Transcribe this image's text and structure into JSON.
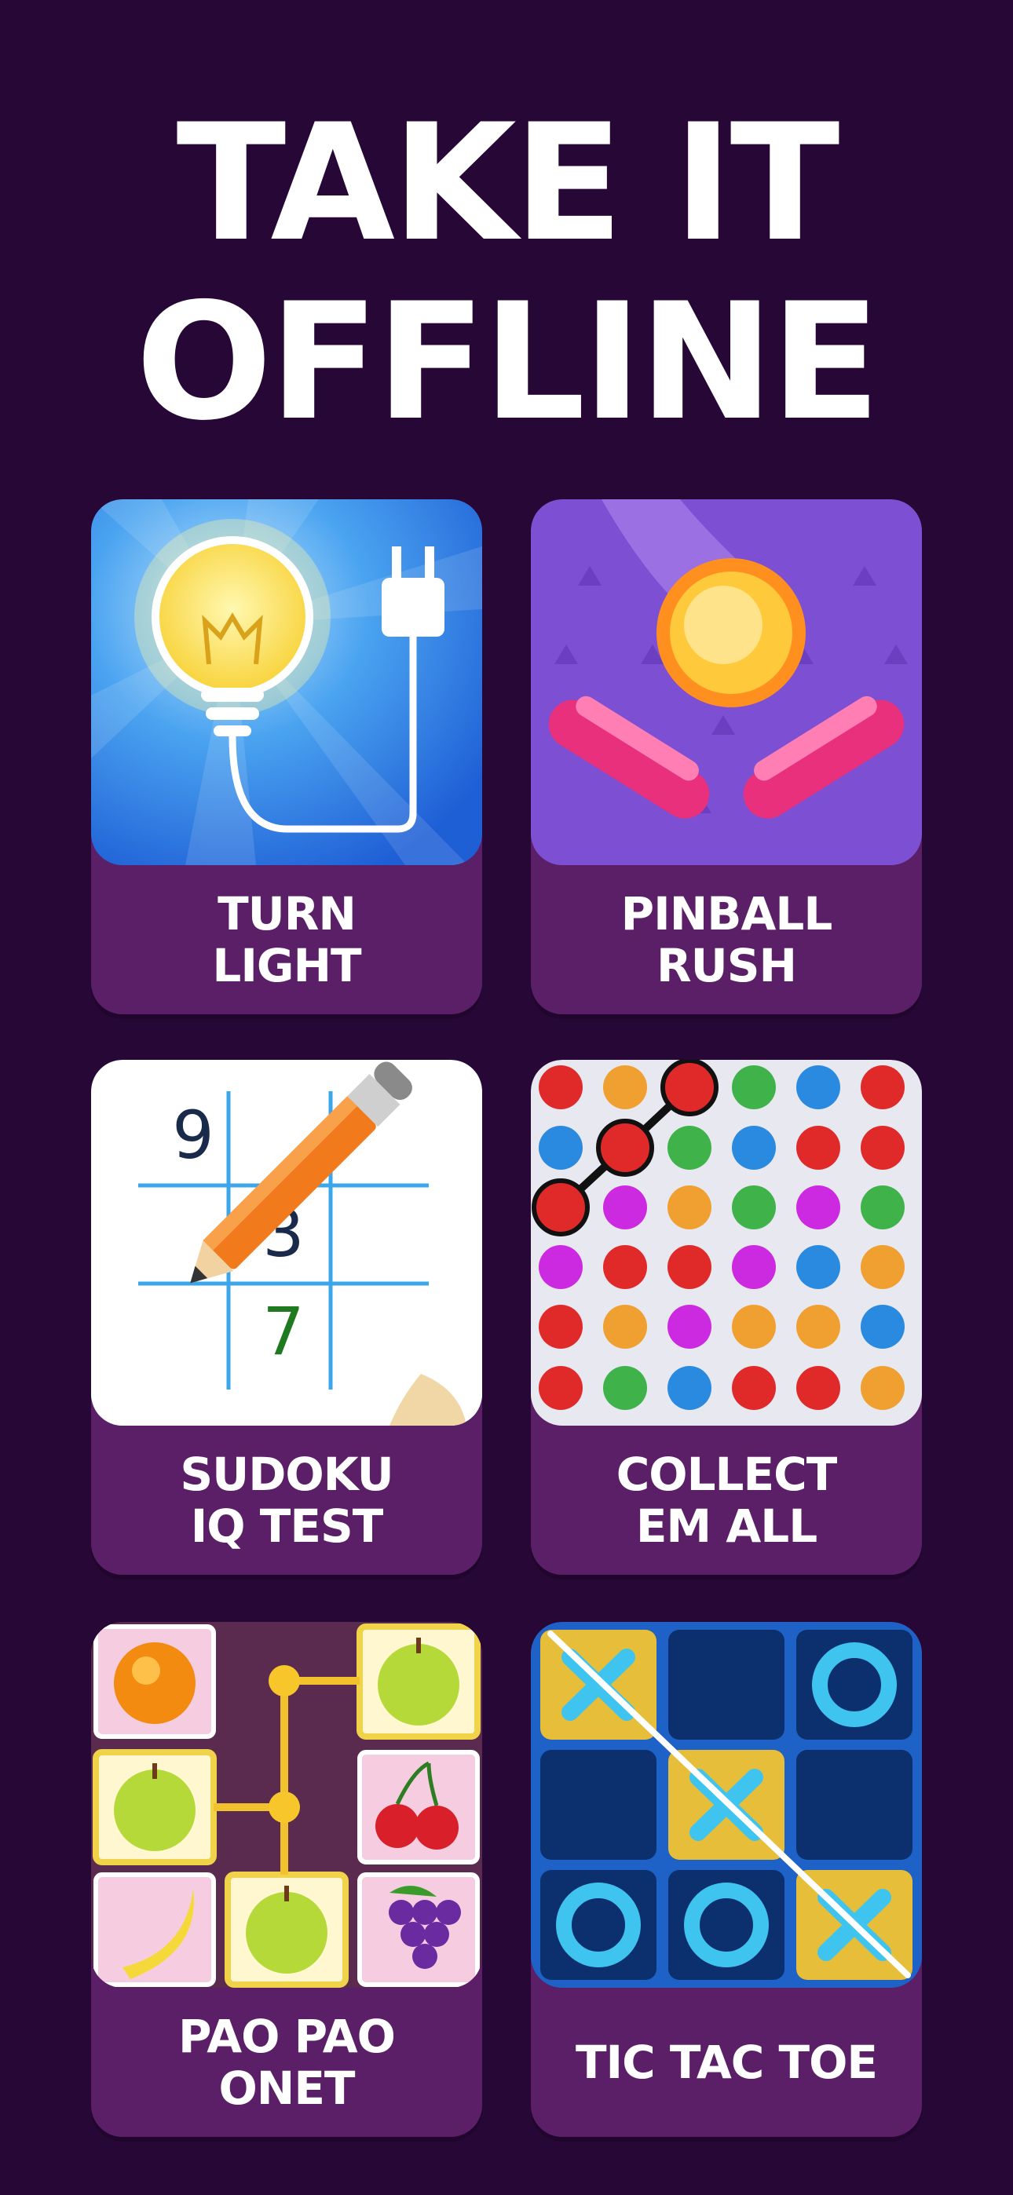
{
  "headline": {
    "line1": "TAKE IT",
    "line2": "OFFLINE"
  },
  "games": [
    {
      "label": "TURN\nLIGHT",
      "icon": "lightbulb-icon"
    },
    {
      "label": "PINBALL\nRUSH",
      "icon": "pinball-icon"
    },
    {
      "label": "SUDOKU\nIQ TEST",
      "icon": "sudoku-icon"
    },
    {
      "label": "COLLECT\nEM ALL",
      "icon": "dots-icon"
    },
    {
      "label": "PAO PAO\nONET",
      "icon": "fruit-match-icon"
    },
    {
      "label": "TIC TAC TOE",
      "icon": "tic-tac-toe-icon"
    }
  ],
  "sudoku_digits": {
    "d1": "9",
    "d2": "3",
    "d3": "7"
  },
  "colors": {
    "background": "#260736",
    "card": "#5a1f66"
  }
}
